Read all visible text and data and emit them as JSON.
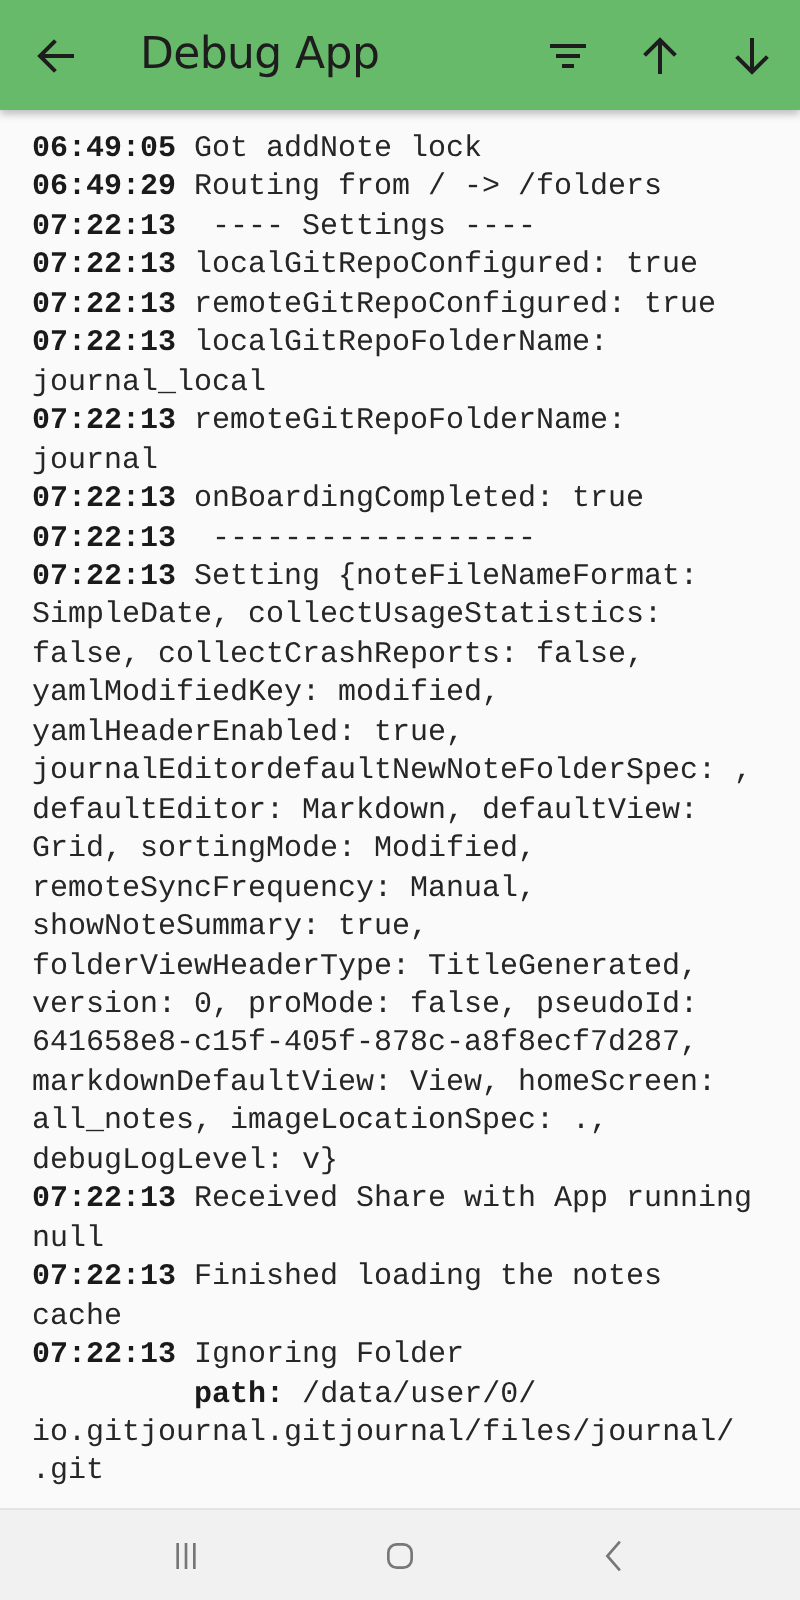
{
  "app_bar": {
    "title": "Debug App"
  },
  "log": [
    {
      "time": "06:49:05",
      "message": "Got addNote lock"
    },
    {
      "time": "06:49:29",
      "message": "Routing from / -> /folders"
    },
    {
      "time": "07:22:13",
      "message": " ---- Settings ----"
    },
    {
      "time": "07:22:13",
      "message": "localGitRepoConfigured: true"
    },
    {
      "time": "07:22:13",
      "message": "remoteGitRepoConfigured: true"
    },
    {
      "time": "07:22:13",
      "message": "localGitRepoFolderName: journal_local"
    },
    {
      "time": "07:22:13",
      "message": "remoteGitRepoFolderName: journal"
    },
    {
      "time": "07:22:13",
      "message": "onBoardingCompleted: true"
    },
    {
      "time": "07:22:13",
      "message": " ------------------"
    },
    {
      "time": "07:22:13",
      "message": "Setting {noteFileNameFormat: SimpleDate, collectUsageStatistics: false, collectCrashReports: false, yamlModifiedKey: modified, yamlHeaderEnabled: true, journalEditordefaultNewNoteFolderSpec: , defaultEditor: Markdown, defaultView: Grid, sortingMode: Modified, remoteSyncFrequency: Manual, showNoteSummary: true, folderViewHeaderType: TitleGenerated, version: 0, proMode: false, pseudoId: 641658e8-c15f-405f-878c-a8f8ecf7d287, markdownDefaultView: View, homeScreen: all_notes, imageLocationSpec: ., debugLogLevel: v}"
    },
    {
      "time": "07:22:13",
      "message": "Received Share with App running null"
    },
    {
      "time": "07:22:13",
      "message": "Finished loading the notes cache"
    },
    {
      "time": "07:22:13",
      "message": "Ignoring Folder",
      "detail": {
        "label": "path:",
        "value": "/data/user/0/io.gitjournal.gitjournal/files/journal/.git"
      }
    }
  ]
}
